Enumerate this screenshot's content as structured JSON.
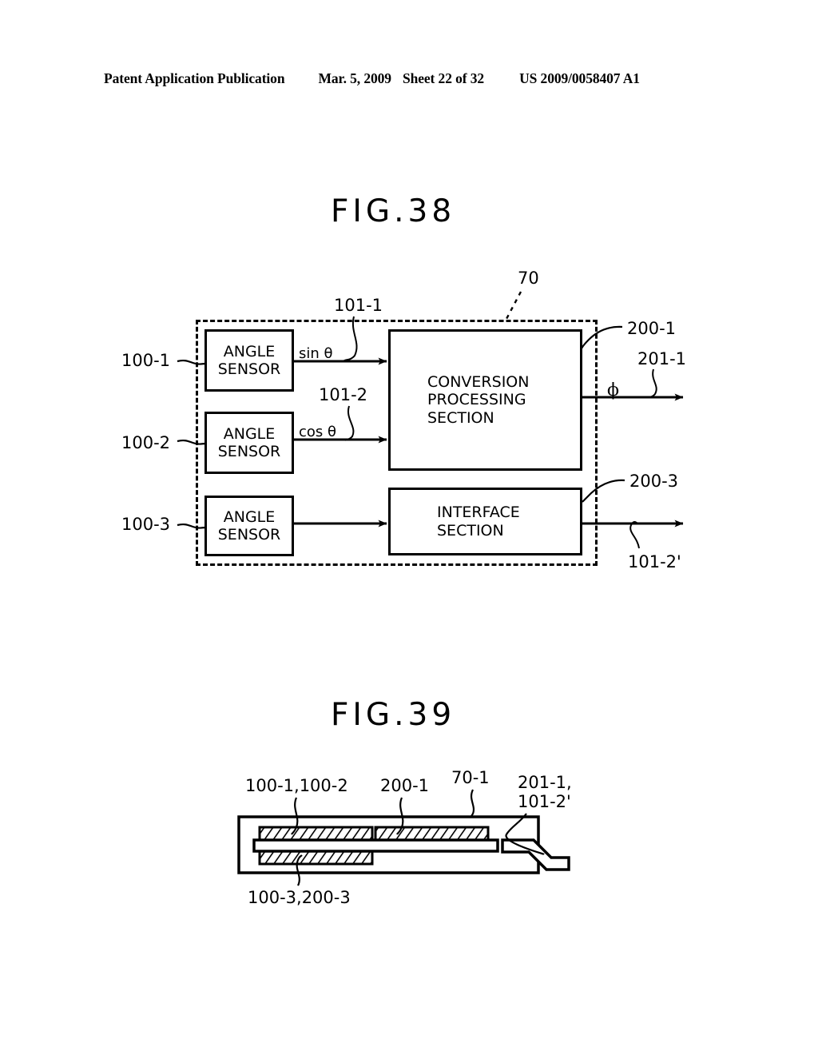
{
  "header": {
    "publication": "Patent Application Publication",
    "date": "Mar. 5, 2009",
    "sheet": "Sheet 22 of 32",
    "patent_number": "US 2009/0058407 A1"
  },
  "figures": [
    {
      "title": "FIG.38",
      "type": "block-diagram",
      "enclosure_ref": "70",
      "blocks": [
        {
          "ref": "100-1",
          "label": "ANGLE\nSENSOR"
        },
        {
          "ref": "100-2",
          "label": "ANGLE\nSENSOR"
        },
        {
          "ref": "100-3",
          "label": "ANGLE\nSENSOR"
        },
        {
          "ref": "200-1",
          "label": "CONVERSION\nPROCESSING\nSECTION"
        },
        {
          "ref": "200-3",
          "label": "INTERFACE\nSECTION"
        }
      ],
      "signals": [
        {
          "ref": "101-1",
          "label": "sin θ"
        },
        {
          "ref": "101-2",
          "label": "cos θ"
        },
        {
          "ref": "201-1",
          "label": "ϕ"
        },
        {
          "ref": "101-2'",
          "label": ""
        }
      ]
    },
    {
      "title": "FIG.39",
      "type": "cross-section",
      "package_ref": "70-1",
      "callouts": [
        {
          "ref": "100-1,100-2",
          "position": "top-left"
        },
        {
          "ref": "200-1",
          "position": "top-center"
        },
        {
          "ref": "70-1",
          "position": "top-right"
        },
        {
          "ref": "201-1,\n101-2'",
          "position": "right"
        },
        {
          "ref": "100-3,200-3",
          "position": "bottom-left"
        }
      ]
    }
  ],
  "colors": {
    "ink": "#000000",
    "paper": "#ffffff"
  }
}
